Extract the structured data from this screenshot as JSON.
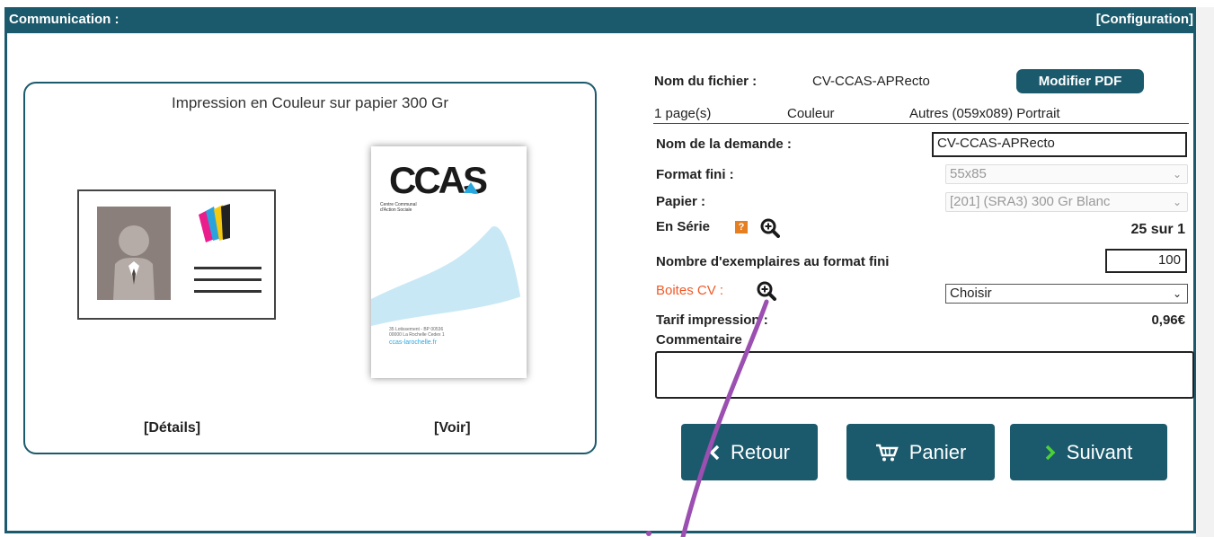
{
  "header": {
    "title": "Communication :",
    "config_link": "[Configuration]"
  },
  "card": {
    "title": "Impression en Couleur sur papier 300 Gr",
    "details_link": "[Détails]",
    "view_link": "[Voir]",
    "preview": {
      "logo": "CCAS",
      "org_line1": "Centre Communal",
      "org_line2": "d'Action Sociale",
      "address_line1": "35 Lotissement - BP 00536",
      "address_line2": "00000 La Rochelle Cedex 1",
      "website": "ccas-larochelle.fr"
    }
  },
  "file": {
    "label": "Nom du fichier :",
    "name": "CV-CCAS-APRecto",
    "modify_button": "Modifier PDF",
    "pages": "1 page(s)",
    "color": "Couleur",
    "size": "Autres (059x089) Portrait"
  },
  "form": {
    "request_name_label": "Nom de la demande :",
    "request_name_value": "CV-CCAS-APRecto",
    "format_label": "Format fini :",
    "format_value": "55x85",
    "paper_label": "Papier :",
    "paper_value": "[201] (SRA3) 300 Gr Blanc",
    "series_label": "En Série",
    "series_help": "?",
    "series_value": "25 sur 1",
    "copies_label": "Nombre d'exemplaires au format fini",
    "copies_value": "100",
    "boxes_label": "Boites CV :",
    "boxes_value": "Choisir",
    "price_label": "Tarif impression :",
    "price_value": "0,96€",
    "comment_label": "Commentaire",
    "comment_value": ""
  },
  "buttons": {
    "back": "Retour",
    "cart": "Panier",
    "next": "Suivant"
  },
  "colors": {
    "primary": "#1b5a6c",
    "accent_orange": "#f05a28",
    "annotation": "#9b4fb0"
  }
}
